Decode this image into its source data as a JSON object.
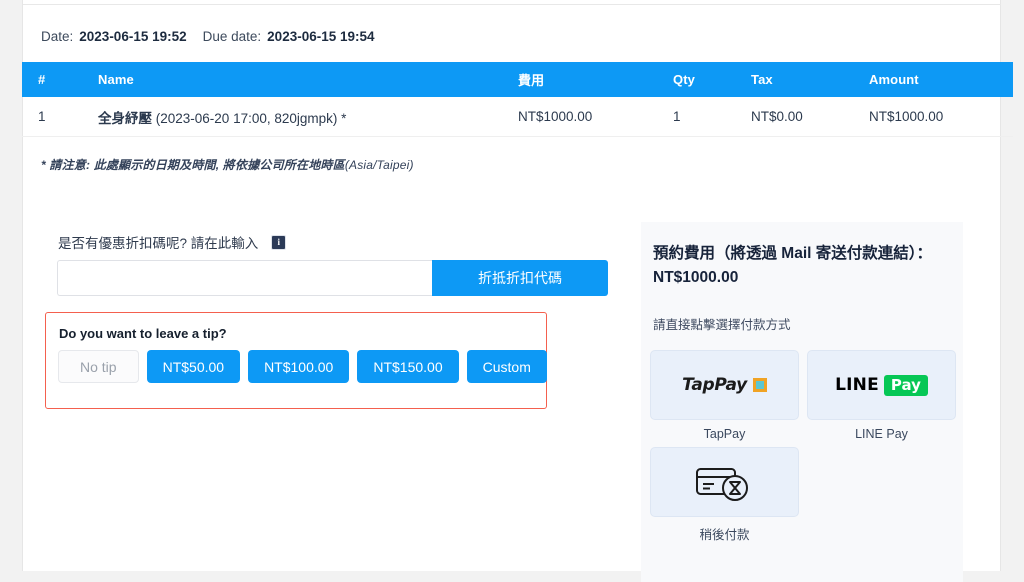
{
  "meta": {
    "date_label": "Date:",
    "date_value": "2023-06-15 19:52",
    "due_label": "Due date:",
    "due_value": "2023-06-15 19:54"
  },
  "invoice_table": {
    "headers": [
      "#",
      "Name",
      "費用",
      "Qty",
      "Tax",
      "Amount"
    ],
    "rows": [
      {
        "num": "1",
        "service": "全身紓壓",
        "meta": "(2023-06-20 17:00, 820jgmpk) *",
        "fee": "NT$1000.00",
        "qty": "1",
        "tax": "NT$0.00",
        "amount": "NT$1000.00"
      }
    ],
    "footnote_prefix": "* 請注意: 此處顯示的日期及時間, 將依據公司所在地時區",
    "footnote_zone": "(Asia/Taipei)"
  },
  "coupon": {
    "label": "是否有優惠折扣碼呢? 請在此輸入",
    "info_icon": "info-icon",
    "info_glyph": "i",
    "input_value": "",
    "input_placeholder": "",
    "apply_label": "折抵折扣代碼"
  },
  "tip": {
    "title": "Do you want to leave a tip?",
    "options": [
      {
        "label": "No tip",
        "style": "muted"
      },
      {
        "label": "NT$50.00",
        "style": "primary"
      },
      {
        "label": "NT$100.00",
        "style": "primary"
      },
      {
        "label": "NT$150.00",
        "style": "primary"
      },
      {
        "label": "Custom",
        "style": "primary"
      }
    ]
  },
  "payment": {
    "title": "預約費用（將透過 Mail 寄送付款連結）： NT$1000.00",
    "subtitle": "請直接點擊選擇付款方式",
    "methods": [
      {
        "caption": "TapPay",
        "logo": "tappay-logo",
        "word": "TapPay"
      },
      {
        "caption": "LINE Pay",
        "logo": "linepay-logo",
        "word": "LINE",
        "chip": "Pay"
      },
      {
        "caption": "稍後付款",
        "logo": "card-clock-icon"
      }
    ]
  },
  "colors": {
    "accent_blue": "#0d99f5",
    "tip_border_red": "#f4604e",
    "panel_bg": "#f8f9fb",
    "card_bg": "#e9f0fa",
    "line_green": "#06c755",
    "tappay_orange": "#f0a324",
    "tappay_teal": "#5cc6d0"
  }
}
